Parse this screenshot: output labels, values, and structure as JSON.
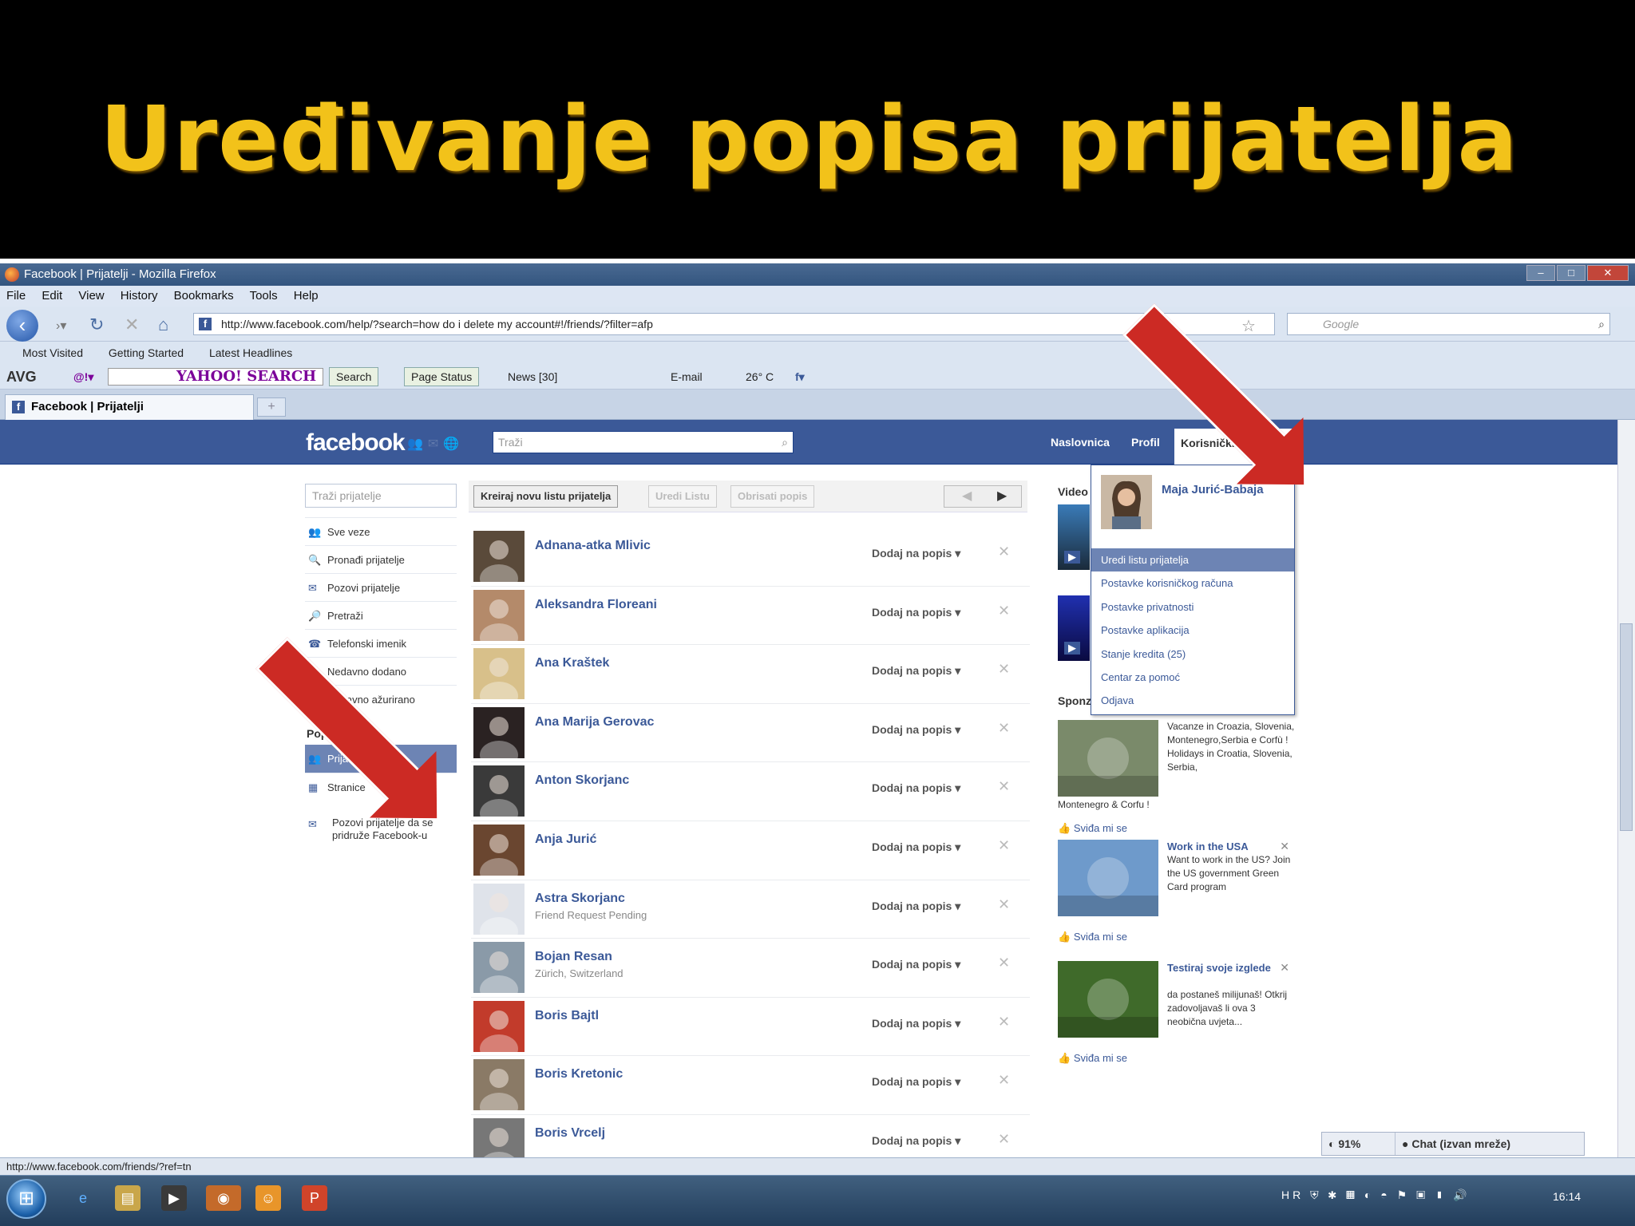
{
  "slide": {
    "title": "Uređivanje popisa prijatelja"
  },
  "browser": {
    "window_title": "Facebook | Prijatelji - Mozilla Firefox",
    "menu": [
      "File",
      "Edit",
      "View",
      "History",
      "Bookmarks",
      "Tools",
      "Help"
    ],
    "url": "http://www.facebook.com/help/?search=how do i delete my account#!/friends/?filter=afp",
    "search_placeholder": "Google",
    "bookmarks": [
      "Most Visited",
      "Getting Started",
      "Latest Headlines"
    ],
    "avg_toolbar": {
      "avg": "AVG",
      "yahoo": "YAHOO! SEARCH",
      "search_btn": "Search",
      "page_status": "Page Status",
      "news": "News [30]",
      "email": "E-mail",
      "weather": "26° C"
    },
    "tab_label": "Facebook | Prijatelji",
    "status_url": "http://www.facebook.com/friends/?ref=tn"
  },
  "facebook": {
    "logo": "facebook",
    "search_placeholder": "Traži",
    "nav": {
      "home": "Naslovnica",
      "profile": "Profil",
      "account": "Korisnički račun ▾"
    },
    "left": {
      "search_placeholder": "Traži prijatelje",
      "items": [
        {
          "icon": "👥",
          "label": "Sve veze"
        },
        {
          "icon": "🔍",
          "label": "Pronađi prijatelje"
        },
        {
          "icon": "✉",
          "label": "Pozovi prijatelje"
        },
        {
          "icon": "🔎",
          "label": "Pretraži"
        },
        {
          "icon": "☎",
          "label": "Telefonski imenik"
        },
        {
          "icon": "👤",
          "label": "Nedavno dodano"
        },
        {
          "icon": "✎",
          "label": "Nedavno ažurirano"
        }
      ],
      "lists_header": "Popisi",
      "lists": [
        {
          "icon": "👥",
          "label": "Prijatelji"
        },
        {
          "icon": "▦",
          "label": "Stranice"
        }
      ],
      "invite": {
        "icon": "✉",
        "label": "Pozovi prijatelje da se pridruže Facebook-u"
      }
    },
    "actions": {
      "create": "Kreiraj novu listu prijatelja",
      "edit": "Uredi Listu",
      "delete": "Obrisati popis",
      "prev": "◀",
      "next": "▶"
    },
    "friend_action": "Dodaj na popis ▾",
    "remove": "✕",
    "friends": [
      {
        "name": "Adnana-atka Mlivic",
        "sub": "",
        "color": "#5a4a3a"
      },
      {
        "name": "Aleksandra Floreani",
        "sub": "",
        "color": "#b48a6a"
      },
      {
        "name": "Ana Kraštek",
        "sub": "",
        "color": "#d8c08a"
      },
      {
        "name": "Ana Marija Gerovac",
        "sub": "",
        "color": "#2a2222"
      },
      {
        "name": "Anton Skorjanc",
        "sub": "",
        "color": "#3a3a3a"
      },
      {
        "name": "Anja Jurić",
        "sub": "",
        "color": "#6a4630"
      },
      {
        "name": "Astra Skorjanc",
        "sub": "Friend Request Pending",
        "color": "#dfe3ea"
      },
      {
        "name": "Bojan Resan",
        "sub": "Zürich, Switzerland",
        "color": "#8a9aa8"
      },
      {
        "name": "Boris Bajtl",
        "sub": "",
        "color": "#c23b2b"
      },
      {
        "name": "Boris Kretonic",
        "sub": "",
        "color": "#8a7a66"
      },
      {
        "name": "Boris Vrcelj",
        "sub": "",
        "color": "#777777"
      }
    ],
    "right": {
      "video_header": "Video",
      "sponsored_header": "Sponz",
      "ads": [
        {
          "title": "",
          "text": "Vacanze in Croazia, Slovenia, Montenegro,Serbia e Corfù ! Holidays in Croatia, Slovenia, Serbia,",
          "extra": "Montenegro & Corfu !",
          "like": "Sviđa mi se",
          "color": "#7a8a6a"
        },
        {
          "title": "Work in the USA",
          "text": "Want to work in the US? Join the US government Green Card program",
          "extra": "",
          "like": "Sviđa mi se",
          "color": "#6e9acb"
        },
        {
          "title": "Testiraj svoje izglede",
          "text": "da postaneš milijunaš! Otkrij zadovoljavaš li ova 3 neobična uvjeta...",
          "extra": "",
          "like": "Sviđa mi se",
          "color": "#3f6a2a"
        }
      ]
    },
    "dropdown": {
      "name": "Maja Jurić-Babaja",
      "items": [
        "Uredi listu prijatelja",
        "Postavke korisničkog računa",
        "Postavke privatnosti",
        "Postavke aplikacija",
        "Stanje kredita (25)",
        "Centar za pomoć",
        "Odjava"
      ]
    },
    "chat": {
      "percent": "91%",
      "label": "Chat (izvan mreže)"
    }
  },
  "taskbar": {
    "lang": "HR",
    "clock": "16:14"
  },
  "colors": {
    "title_yellow": "#f2c21a",
    "fb_blue": "#3b5998",
    "arrow_red": "#cc2a24"
  }
}
